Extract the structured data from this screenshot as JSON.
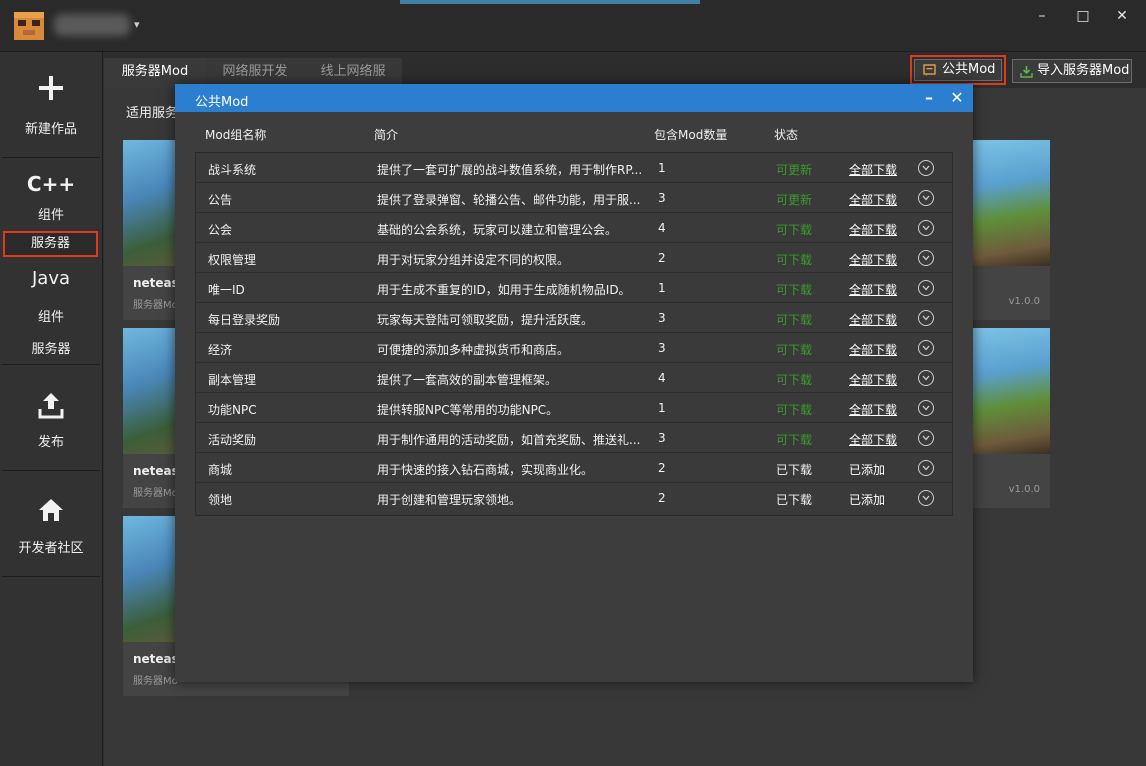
{
  "window": {
    "controls": {
      "minimize": "–",
      "maximize": "□",
      "close": "✕"
    },
    "user_caret": "▾"
  },
  "sidebar": {
    "new_work": "新建作品",
    "cpp_logo": "C++",
    "cpp_component": "组件",
    "cpp_server": "服务器",
    "java_logo": "Java",
    "java_component": "组件",
    "java_server": "服务器",
    "publish": "发布",
    "community": "开发者社区"
  },
  "tabs": [
    {
      "label": "服务器Mod"
    },
    {
      "label": "网络服开发"
    },
    {
      "label": "线上网络服"
    }
  ],
  "toolbar": {
    "public_mod": "公共Mod",
    "import_server_mod": "导入服务器Mod"
  },
  "main": {
    "scope_label": "适用服务",
    "cards": [
      {
        "title": "netease",
        "sub": "服务器Mo",
        "version": ""
      },
      {
        "title": "netease",
        "sub": "服务器Mo",
        "version": ""
      },
      {
        "title": "netease",
        "sub": "服务器Mo",
        "version": ""
      },
      {
        "title": "",
        "sub": "",
        "version": "v1.0.0"
      },
      {
        "title": "",
        "sub": "",
        "version": "v1.0.0"
      }
    ]
  },
  "modal": {
    "title": "公共Mod",
    "minimize": "–",
    "close": "✕",
    "columns": {
      "name": "Mod组名称",
      "desc": "简介",
      "count": "包含Mod数量",
      "status": "状态"
    },
    "rows": [
      {
        "name": "战斗系统",
        "desc": "提供了一套可扩展的战斗数值系统，用于制作RP...",
        "count": "1",
        "status": "可更新",
        "status_color": "#3a9b2c",
        "action": "全部下载"
      },
      {
        "name": "公告",
        "desc": "提供了登录弹窗、轮播公告、邮件功能，用于服...",
        "count": "3",
        "status": "可更新",
        "status_color": "#3a9b2c",
        "action": "全部下载"
      },
      {
        "name": "公会",
        "desc": "基础的公会系统，玩家可以建立和管理公会。",
        "count": "4",
        "status": "可下载",
        "status_color": "#3a9b2c",
        "action": "全部下载"
      },
      {
        "name": "权限管理",
        "desc": "用于对玩家分组并设定不同的权限。",
        "count": "2",
        "status": "可下载",
        "status_color": "#3a9b2c",
        "action": "全部下载"
      },
      {
        "name": "唯一ID",
        "desc": "用于生成不重复的ID，如用于生成随机物品ID。",
        "count": "1",
        "status": "可下载",
        "status_color": "#3a9b2c",
        "action": "全部下载"
      },
      {
        "name": "每日登录奖励",
        "desc": "玩家每天登陆可领取奖励，提升活跃度。",
        "count": "3",
        "status": "可下载",
        "status_color": "#3a9b2c",
        "action": "全部下载"
      },
      {
        "name": "经济",
        "desc": "可便捷的添加多种虚拟货币和商店。",
        "count": "3",
        "status": "可下载",
        "status_color": "#3a9b2c",
        "action": "全部下载"
      },
      {
        "name": "副本管理",
        "desc": "提供了一套高效的副本管理框架。",
        "count": "4",
        "status": "可下载",
        "status_color": "#3a9b2c",
        "action": "全部下载"
      },
      {
        "name": "功能NPC",
        "desc": "提供转服NPC等常用的功能NPC。",
        "count": "1",
        "status": "可下载",
        "status_color": "#3a9b2c",
        "action": "全部下载"
      },
      {
        "name": "活动奖励",
        "desc": "用于制作通用的活动奖励，如首充奖励、推送礼...",
        "count": "3",
        "status": "可下载",
        "status_color": "#3a9b2c",
        "action": "全部下载"
      },
      {
        "name": "商城",
        "desc": "用于快速的接入钻石商城，实现商业化。",
        "count": "2",
        "status": "已下载",
        "status_color": "#f2f2f2",
        "action": "已添加"
      },
      {
        "name": "领地",
        "desc": "用于创建和管理玩家领地。",
        "count": "2",
        "status": "已下载",
        "status_color": "#f2f2f2",
        "action": "已添加"
      }
    ]
  }
}
